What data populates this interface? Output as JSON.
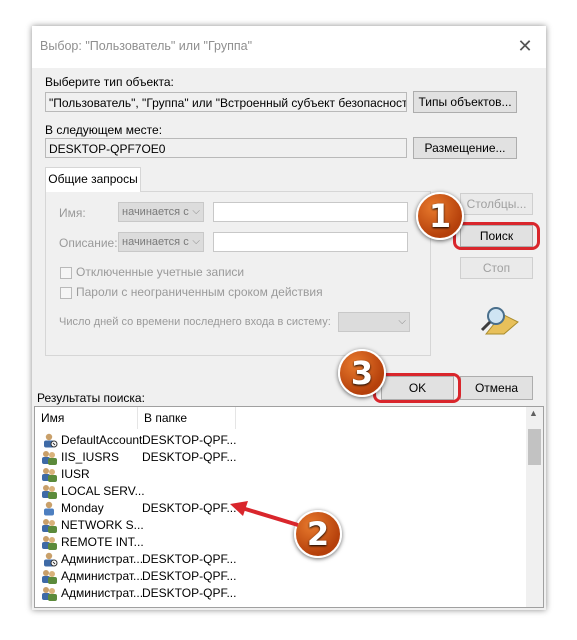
{
  "dialog": {
    "title": "Выбор: \"Пользователь\" или \"Группа\"",
    "close_glyph": "✕"
  },
  "object_type": {
    "label": "Выберите тип объекта:",
    "value": "\"Пользователь\", \"Группа\" или \"Встроенный субъект безопасности\"",
    "button": "Типы объектов..."
  },
  "location": {
    "label": "В следующем месте:",
    "value": "DESKTOP-QPF7OE0",
    "button": "Размещение..."
  },
  "common_queries": {
    "tab": "Общие запросы",
    "name_label": "Имя:",
    "name_mode": "начинается с",
    "description_label": "Описание:",
    "description_mode": "начинается с",
    "disabled_accounts": "Отключенные учетные записи",
    "non_expiring_passwords": "Пароли с неограниченным сроком действия",
    "days_since_login": "Число дней со времени последнего входа в систему:"
  },
  "side_buttons": {
    "columns": "Столбцы...",
    "search": "Поиск",
    "stop": "Стоп"
  },
  "footer": {
    "ok": "OK",
    "cancel": "Отмена"
  },
  "results": {
    "label": "Результаты поиска:",
    "columns": [
      "Имя",
      "В папке"
    ],
    "rows": [
      {
        "name": "DefaultAccount",
        "folder": "DESKTOP-QPF...",
        "icon": "user-account-icon"
      },
      {
        "name": "IIS_IUSRS",
        "folder": "DESKTOP-QPF...",
        "icon": "group-icon"
      },
      {
        "name": "IUSR",
        "folder": "",
        "icon": "group-icon"
      },
      {
        "name": "LOCAL SERV...",
        "folder": "",
        "icon": "group-icon"
      },
      {
        "name": "Monday",
        "folder": "DESKTOP-QPF...",
        "icon": "user-icon"
      },
      {
        "name": "NETWORK S...",
        "folder": "",
        "icon": "group-icon"
      },
      {
        "name": "REMOTE INT...",
        "folder": "",
        "icon": "group-icon"
      },
      {
        "name": "Администрат...",
        "folder": "DESKTOP-QPF...",
        "icon": "user-account-icon"
      },
      {
        "name": "Администрат...",
        "folder": "DESKTOP-QPF...",
        "icon": "group-icon"
      },
      {
        "name": "Администрат...",
        "folder": "DESKTOP-QPF...",
        "icon": "group-icon"
      }
    ]
  },
  "annotations": {
    "step1": "1",
    "step2": "2",
    "step3": "3",
    "highlight_color": "#d9262c",
    "badge_color": "#c4500f"
  }
}
